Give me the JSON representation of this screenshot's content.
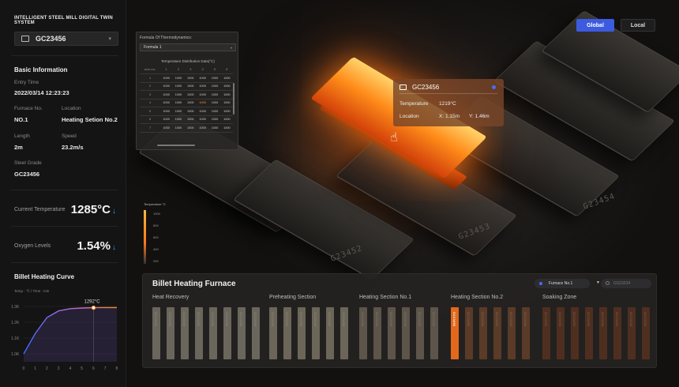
{
  "app": {
    "title": "INTELLIGENT STEEL MILL DIGITAL TWIN SYSTEM"
  },
  "selector": {
    "value": "GC23456"
  },
  "basic": {
    "title": "Basic Information",
    "entry_time_label": "Entry Time",
    "entry_time": "2022/03/14 12:23:23",
    "furnace_label": "Furnace No.",
    "furnace": "NO.1",
    "location_label": "Location",
    "location": "Heating Setion No.2",
    "length_label": "Length",
    "length": "2m",
    "speed_label": "Speed",
    "speed": "23.2m/s",
    "grade_label": "Steel Grade",
    "grade": "GC23456"
  },
  "metrics": {
    "temp_label": "Current Temperature",
    "temp_value": "1285°C",
    "oxygen_label": "Oxygen Levels",
    "oxygen_value": "1.54%"
  },
  "curve": {
    "title": "Billet Heating Curve",
    "axis_note": "Temp : ℃ / Time : min",
    "peak_label": "1292°C"
  },
  "chart_data": {
    "type": "line",
    "title": "Billet Heating Curve",
    "x": [
      0,
      1,
      2,
      3,
      4,
      5,
      6,
      7,
      8
    ],
    "y_ticks": [
      "1.0K",
      "1.1K",
      "1.2K",
      "1.3K"
    ],
    "series": [
      {
        "values": [
          1000,
          1130,
          1230,
          1272,
          1286,
          1290,
          1292,
          1293,
          1293
        ]
      }
    ],
    "marker": {
      "x": 6,
      "y": 1292,
      "label": "1292°C"
    },
    "xlim": [
      0,
      8
    ],
    "ylim": [
      950,
      1350
    ]
  },
  "thermo": {
    "label": "Formula Of Thermodynamics:",
    "formula": "Formula 1",
    "table_title": "Temperature Distribution Data(°C)",
    "corner": "ROW\nCOL",
    "cols": [
      "1",
      "2",
      "3",
      "4",
      "5",
      "6"
    ],
    "rows": [
      {
        "r": "1",
        "v": [
          "1000",
          "1000",
          "1000",
          "1000",
          "1000",
          "1000"
        ]
      },
      {
        "r": "2",
        "v": [
          "1000",
          "1000",
          "1000",
          "1000",
          "1000",
          "1000"
        ]
      },
      {
        "r": "3",
        "v": [
          "1000",
          "1000",
          "1000",
          "1000",
          "1000",
          "1000"
        ]
      },
      {
        "r": "4",
        "v": [
          "1000",
          "1000",
          "1000",
          "1000",
          "1000",
          "1000"
        ]
      },
      {
        "r": "5",
        "v": [
          "1000",
          "1000",
          "1000",
          "1000",
          "1000",
          "1000"
        ]
      },
      {
        "r": "6",
        "v": [
          "1000",
          "1000",
          "1000",
          "1000",
          "1000",
          "1000"
        ]
      },
      {
        "r": "7",
        "v": [
          "1000",
          "1000",
          "1000",
          "1000",
          "1000",
          "1000"
        ]
      }
    ],
    "hot_cell": {
      "row": 3,
      "col": 3
    }
  },
  "temp_legend": {
    "title": "Temperature °C",
    "ticks": [
      "1000",
      "800",
      "600",
      "400",
      "200"
    ]
  },
  "tooltip": {
    "id": "GC23456",
    "temp_label": "Temperature",
    "temp_value": "1219°C",
    "loc_label": "Location",
    "x": "X: 1.15m",
    "y": "Y: 1.46m"
  },
  "scene_labels": [
    "G23452",
    "G23453",
    "G23454"
  ],
  "view": {
    "global": "Global",
    "local": "Local"
  },
  "furnace": {
    "title": "Billet Heating Furnace",
    "select": "Furnace No.1",
    "search_placeholder": "GS23234",
    "sections": [
      {
        "name": "Heat Recovery",
        "count": 8
      },
      {
        "name": "Preheating Section",
        "count": 6
      },
      {
        "name": "Heating Section No.1",
        "count": 6
      },
      {
        "name": "Heating Section No.2",
        "count": 6
      },
      {
        "name": "Soaking Zone",
        "count": 8
      }
    ],
    "slot_label": "GC23456",
    "active_slot": {
      "section": 3,
      "index": 0
    }
  },
  "colors": {
    "accent": "#3c5be0",
    "hot": "#ff7a1a",
    "heat_recovery": "#6a665c",
    "preheat": "#6b6658",
    "heating1": "#5d544a",
    "heating2": "#5a3b27",
    "soaking": "#4e2f1f",
    "active_slot": "#e2681c"
  }
}
